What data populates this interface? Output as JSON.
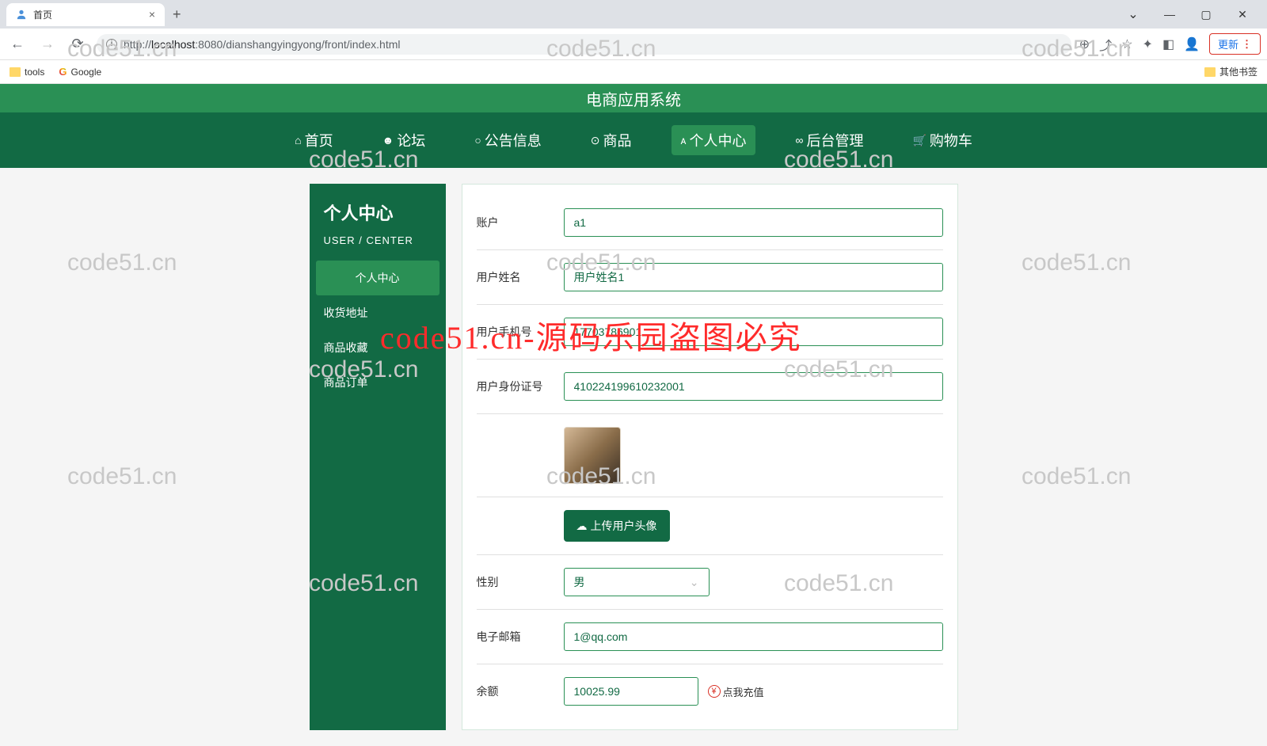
{
  "browser": {
    "tab_title": "首页",
    "url_scheme": "http://",
    "url_host": "localhost",
    "url_port": ":8080",
    "url_path": "/dianshangyingyong/front/index.html",
    "update_label": "更新"
  },
  "bookmarks": {
    "tools": "tools",
    "google": "Google",
    "other": "其他书签"
  },
  "site": {
    "title": "电商应用系统",
    "nav": {
      "home": "首页",
      "forum": "论坛",
      "notice": "公告信息",
      "goods": "商品",
      "user_center": "个人中心",
      "admin": "后台管理",
      "cart": "购物车"
    }
  },
  "sidebar": {
    "title": "个人中心",
    "subtitle": "USER / CENTER",
    "items": [
      {
        "label": "个人中心"
      },
      {
        "label": "收货地址"
      },
      {
        "label": "商品收藏"
      },
      {
        "label": "商品订单"
      }
    ]
  },
  "form": {
    "account_label": "账户",
    "account_value": "a1",
    "name_label": "用户姓名",
    "name_value": "用户姓名1",
    "phone_label": "用户手机号",
    "phone_value": "17703786901",
    "idcard_label": "用户身份证号",
    "idcard_value": "410224199610232001",
    "upload_label": "上传用户头像",
    "gender_label": "性别",
    "gender_value": "男",
    "email_label": "电子邮箱",
    "email_value": "1@qq.com",
    "balance_label": "余额",
    "balance_value": "10025.99",
    "recharge_label": "点我充值"
  },
  "watermark_text": "code51.cn",
  "red_watermark": "code51.cn-源码乐园盗图必究"
}
